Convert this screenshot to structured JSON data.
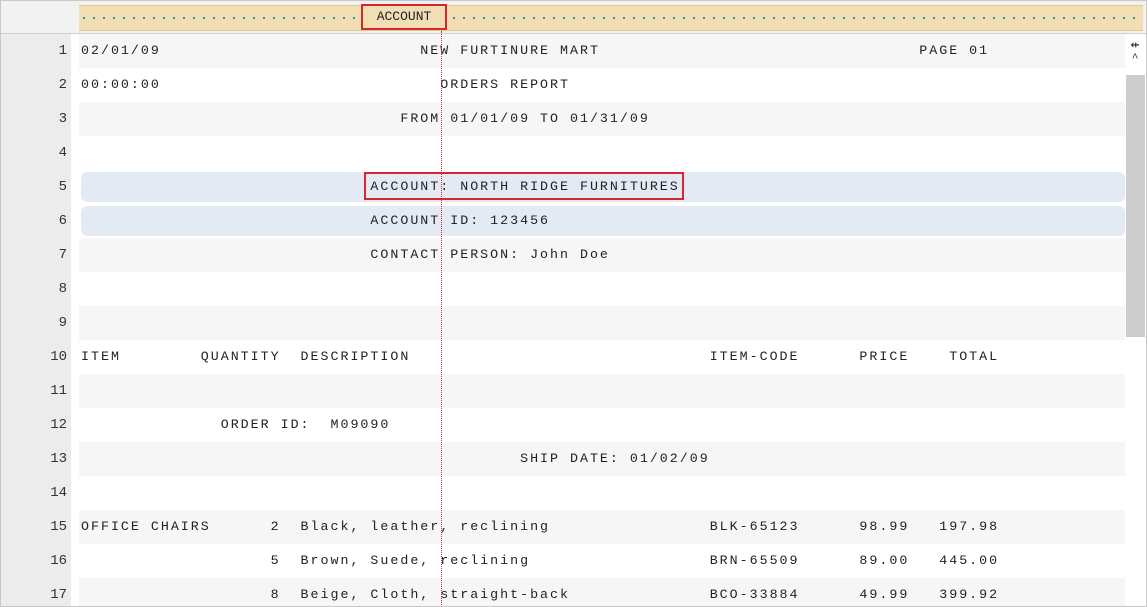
{
  "ruler": {
    "field_label": "ACCOUNT"
  },
  "lines": [
    {
      "n": "1",
      "text": "02/01/09                          NEW FURTINURE MART                                PAGE 01"
    },
    {
      "n": "2",
      "text": "00:00:00                            ORDERS REPORT"
    },
    {
      "n": "3",
      "text": "                                FROM 01/01/09 TO 01/31/09"
    },
    {
      "n": "4",
      "text": ""
    },
    {
      "n": "5",
      "text": "                             ACCOUNT: NORTH RIDGE FURNITURES"
    },
    {
      "n": "6",
      "text": "                             ACCOUNT ID: 123456"
    },
    {
      "n": "7",
      "text": "                             CONTACT PERSON: John Doe"
    },
    {
      "n": "8",
      "text": ""
    },
    {
      "n": "9",
      "text": ""
    },
    {
      "n": "10",
      "text": "ITEM        QUANTITY  DESCRIPTION                              ITEM-CODE      PRICE    TOTAL"
    },
    {
      "n": "11",
      "text": ""
    },
    {
      "n": "12",
      "text": "              ORDER ID:  M09090"
    },
    {
      "n": "13",
      "text": "                                            SHIP DATE: 01/02/09"
    },
    {
      "n": "14",
      "text": ""
    },
    {
      "n": "15",
      "text": "OFFICE CHAIRS      2  Black, leather, reclining                BLK-65123      98.99   197.98"
    },
    {
      "n": "16",
      "text": "                   5  Brown, Suede, reclining                  BRN-65509      89.00   445.00"
    },
    {
      "n": "17",
      "text": "                   8  Beige, Cloth, straight-back              BCO-33884      49.99   399.92"
    }
  ],
  "highlighted_lines": [
    "5",
    "6"
  ],
  "colors": {
    "highlight": "#d9262b",
    "selection": "#e4eaf3",
    "ruler": "#f1deb5"
  }
}
